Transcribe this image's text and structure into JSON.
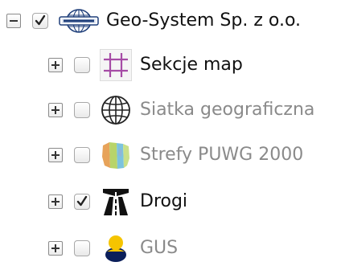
{
  "tree": {
    "root": {
      "label": "Geo-System Sp. z o.o.",
      "expanded": true,
      "checked": true,
      "icon": "globe-logo-icon",
      "color": "#111111"
    },
    "layers": [
      {
        "label": "Sekcje map",
        "checked": false,
        "expanded": false,
        "icon": "grid-frame-icon",
        "color": "#111111"
      },
      {
        "label": "Siatka geograficzna",
        "checked": false,
        "expanded": false,
        "icon": "globe-grid-icon",
        "color": "#8a8a8a"
      },
      {
        "label": "Strefy PUWG 2000",
        "checked": false,
        "expanded": false,
        "icon": "zones-map-icon",
        "color": "#8a8a8a"
      },
      {
        "label": "Drogi",
        "checked": true,
        "expanded": false,
        "icon": "highway-icon",
        "color": "#111111"
      },
      {
        "label": "GUS",
        "checked": false,
        "expanded": false,
        "icon": "gus-logo-icon",
        "color": "#8a8a8a"
      }
    ]
  }
}
